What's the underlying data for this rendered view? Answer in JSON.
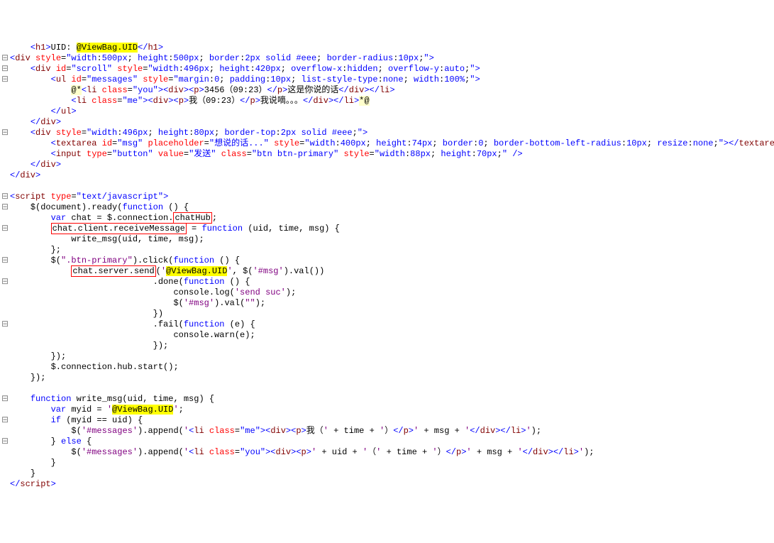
{
  "lines": [
    {
      "gutter": " ",
      "html": "    <a>&lt;</a><n>h1</n><a>&gt;</a><t>UID: </t><y>@ViewBag.UID</y><a>&lt;/</a><n>h1</n><a>&gt;</a>"
    },
    {
      "gutter": "⊟",
      "html": "<a>&lt;</a><n>div</n> <r>style</r><t>=</t><v>\"width</v><t>:</t><v>500px</v><t>; </t><v>height</v><t>:</t><v>500px</v><t>; </t><v>border</v><t>:</t><v>2px solid #eee</v><t>; </t><v>border-radius</v><t>:</t><v>10px</v><t>;</t><v>\"</v><a>&gt;</a>"
    },
    {
      "gutter": "⊟",
      "html": "    <a>&lt;</a><n>div</n> <r>id</r><t>=</t><v>\"scroll\"</v> <r>style</r><t>=</t><v>\"width</v><t>:</t><v>496px</v><t>; </t><v>height</v><t>:</t><v>420px</v><t>; </t><v>overflow-x</v><t>:</t><v>hidden</v><t>; </t><v>overflow-y</v><t>:</t><v>auto</v><t>;</t><v>\"</v><a>&gt;</a>"
    },
    {
      "gutter": "⊟",
      "html": "        <a>&lt;</a><n>ul</n> <r>id</r><t>=</t><v>\"messages\"</v> <r>style</r><t>=</t><v>\"margin</v><t>:</t><v>0</v><t>; </t><v>padding</v><t>:</t><v>10px</v><t>; </t><v>list-style-type</v><t>:</t><v>none</v><t>; </t><v>width</v><t>:</t><v>100%</v><t>;</t><v>\"</v><a>&gt;</a>"
    },
    {
      "gutter": " ",
      "html": "            <y2>@*</y2><a>&lt;</a><n>li</n> <r>class</r><t>=</t><v>\"you\"</v><a>&gt;&lt;</a><n>div</n><a>&gt;&lt;</a><n>p</n><a>&gt;</a><t>3456（09:23）</t><a>&lt;/</a><n>p</n><a>&gt;</a><t>这是你说的话</t><a>&lt;/</a><n>div</n><a>&gt;&lt;/</a><n>li</n><a>&gt;</a>"
    },
    {
      "gutter": " ",
      "html": "            <a>&lt;</a><n>li</n> <r>class</r><t>=</t><v>\"me\"</v><a>&gt;&lt;</a><n>div</n><a>&gt;&lt;</a><n>p</n><a>&gt;</a><t>我（09:23）</t><a>&lt;/</a><n>p</n><a>&gt;</a><t>我说嘀。。。</t><a>&lt;/</a><n>div</n><a>&gt;&lt;/</a><n>li</n><a>&gt;</a><y2>*@</y2>"
    },
    {
      "gutter": " ",
      "html": "        <a>&lt;/</a><n>ul</n><a>&gt;</a>"
    },
    {
      "gutter": " ",
      "html": "    <a>&lt;/</a><n>div</n><a>&gt;</a>"
    },
    {
      "gutter": "⊟",
      "html": "    <a>&lt;</a><n>div</n> <r>style</r><t>=</t><v>\"width</v><t>:</t><v>496px</v><t>; </t><v>height</v><t>:</t><v>80px</v><t>; </t><v>border-top</v><t>:</t><v>2px solid #eee</v><t>;</t><v>\"</v><a>&gt;</a>"
    },
    {
      "gutter": " ",
      "html": "        <a>&lt;</a><n>textarea</n> <r>id</r><t>=</t><v>\"msg\"</v> <r>placeholder</r><t>=</t><v>\"想说的话...\"</v> <r>style</r><t>=</t><v>\"width</v><t>:</t><v>400px</v><t>; </t><v>height</v><t>:</t><v>74px</v><t>; </t><v>border</v><t>:</t><v>0</v><t>; </t><v>border-bottom-left-radius</v><t>:</t><v>10px</v><t>; </t><v>resize</v><t>:</t><v>none</v><t>;</t><v>\"</v><a>&gt;&lt;/</a><n>textarea</n><a>&gt;</a>"
    },
    {
      "gutter": " ",
      "html": "        <a>&lt;</a><n>input</n> <r>type</r><t>=</t><v>\"button\"</v> <r>value</r><t>=</t><v>\"发送\"</v> <r>class</r><t>=</t><v>\"btn btn-primary\"</v> <r>style</r><t>=</t><v>\"width</v><t>:</t><v>88px</v><t>; </t><v>height</v><t>:</t><v>70px</v><t>;</t><v>\"</v> <a>/&gt;</a>"
    },
    {
      "gutter": " ",
      "html": "    <a>&lt;/</a><n>div</n><a>&gt;</a>"
    },
    {
      "gutter": " ",
      "html": "<a>&lt;/</a><n>div</n><a>&gt;</a>"
    },
    {
      "gutter": " ",
      "html": ""
    },
    {
      "gutter": "⊟",
      "html": "<a>&lt;</a><n>script</n> <r>type</r><t>=</t><v>\"text/javascript\"</v><a>&gt;</a>"
    },
    {
      "gutter": "⊟",
      "html": "    <t>$(document).ready(</t><k>function</k><t> () {</t>"
    },
    {
      "gutter": " ",
      "html": "        <k>var</k><t> chat = $.connection.</t><rb>chatHub</rb><t>;</t>"
    },
    {
      "gutter": "⊟",
      "html": "        <rb>chat.client.receiveMessage</rb><t> = </t><k>function</k><t> (uid, time, msg) {</t>"
    },
    {
      "gutter": " ",
      "html": "            <t>write_msg(uid, time, msg);</t>"
    },
    {
      "gutter": " ",
      "html": "        <t>};</t>"
    },
    {
      "gutter": "⊟",
      "html": "        <t>$(</t><s>\".btn-primary\"</s><t>).click(</t><k>function</k><t> () {</t>"
    },
    {
      "gutter": " ",
      "html": "            <rb>chat.server.send</rb><t>(</t><s>'</s><y>@ViewBag.UID</y><s>'</s><t>, $(</t><s>'#msg'</s><t>).val())</t>"
    },
    {
      "gutter": "⊟",
      "html": "                            <t>.done(</t><k>function</k><t> () {</t>"
    },
    {
      "gutter": " ",
      "html": "                                <t>console.log(</t><s>'send suc'</s><t>);</t>"
    },
    {
      "gutter": " ",
      "html": "                                <t>$(</t><s>'#msg'</s><t>).val(</t><s>\"\"</s><t>);</t>"
    },
    {
      "gutter": " ",
      "html": "                            <t>})</t>"
    },
    {
      "gutter": "⊟",
      "html": "                            <t>.fail(</t><k>function</k><t> (e) {</t>"
    },
    {
      "gutter": " ",
      "html": "                                <t>console.warn(e);</t>"
    },
    {
      "gutter": " ",
      "html": "                            <t>});</t>"
    },
    {
      "gutter": " ",
      "html": "        <t>});</t>"
    },
    {
      "gutter": " ",
      "html": "        <t>$.connection.hub.start();</t>"
    },
    {
      "gutter": " ",
      "html": "    <t>});</t>"
    },
    {
      "gutter": " ",
      "html": ""
    },
    {
      "gutter": "⊟",
      "html": "    <k>function</k><t> write_msg(uid, time, msg) {</t>"
    },
    {
      "gutter": " ",
      "html": "        <k>var</k><t> myid = </t><s>'</s><y>@ViewBag.UID</y><s>'</s><t>;</t>"
    },
    {
      "gutter": "⊟",
      "html": "        <k>if</k><t> (myid == uid) {</t>"
    },
    {
      "gutter": " ",
      "html": "            <t>$(</t><s>'#messages'</s><t>).append(</t><s>'</s><a>&lt;</a><n>li</n> <r>class</r><t>=</t><v>\"me\"</v><a>&gt;&lt;</a><n>div</n><a>&gt;&lt;</a><n>p</n><a>&gt;</a><t>我（</t><s>'</s><t> + time + </t><s>'</s><t>）</t><a>&lt;/</a><n>p</n><a>&gt;</a><s>'</s><t> + msg + </t><s>'</s><a>&lt;/</a><n>div</n><a>&gt;&lt;/</a><n>li</n><a>&gt;</a><s>'</s><t>);</t>"
    },
    {
      "gutter": "⊟",
      "html": "        <t>} </t><k>else</k><t> {</t>"
    },
    {
      "gutter": " ",
      "html": "            <t>$(</t><s>'#messages'</s><t>).append(</t><s>'</s><a>&lt;</a><n>li</n> <r>class</r><t>=</t><v>\"you\"</v><a>&gt;&lt;</a><n>div</n><a>&gt;&lt;</a><n>p</n><a>&gt;</a><s>'</s><t> + uid + </t><s>'</s><t>（</t><s>'</s><t> + time + </t><s>'</s><t>）</t><a>&lt;/</a><n>p</n><a>&gt;</a><s>'</s><t> + msg + </t><s>'</s><a>&lt;/</a><n>div</n><a>&gt;&lt;/</a><n>li</n><a>&gt;</a><s>'</s><t>);</t>"
    },
    {
      "gutter": " ",
      "html": "        <t>}</t>"
    },
    {
      "gutter": " ",
      "html": "    <t>}</t>"
    },
    {
      "gutter": " ",
      "html": "<a>&lt;/</a><n>script</n><a>&gt;</a>"
    }
  ]
}
